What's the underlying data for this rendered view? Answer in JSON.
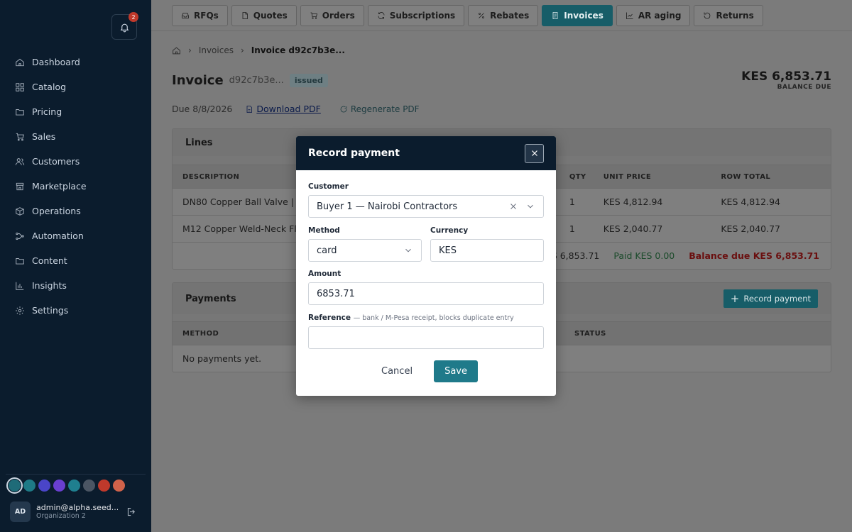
{
  "notifications": {
    "count": "2"
  },
  "sidebar": {
    "items": [
      {
        "label": "Dashboard",
        "icon": "home-icon"
      },
      {
        "label": "Catalog",
        "icon": "grid-icon"
      },
      {
        "label": "Pricing",
        "icon": "folder-icon"
      },
      {
        "label": "Sales",
        "icon": "cart-icon"
      },
      {
        "label": "Customers",
        "icon": "users-icon"
      },
      {
        "label": "Marketplace",
        "icon": "store-icon"
      },
      {
        "label": "Operations",
        "icon": "box-icon"
      },
      {
        "label": "Automation",
        "icon": "flow-icon"
      },
      {
        "label": "Content",
        "icon": "folder-icon"
      },
      {
        "label": "Insights",
        "icon": "chart-icon"
      },
      {
        "label": "Settings",
        "icon": "gear-icon"
      }
    ],
    "swatches": [
      "#1f6b78",
      "#1e7a86",
      "#4a45c8",
      "#6a3fd0",
      "#1f7f8f",
      "#4b5563",
      "#c0392b",
      "#d0624a"
    ],
    "user": {
      "initials": "AD",
      "email": "admin@alpha.seed....",
      "org": "Organization 2"
    }
  },
  "tabs": [
    {
      "label": "RFQs",
      "icon": "inbox-icon"
    },
    {
      "label": "Quotes",
      "icon": "doc-icon"
    },
    {
      "label": "Orders",
      "icon": "cart-icon"
    },
    {
      "label": "Subscriptions",
      "icon": "refresh-icon"
    },
    {
      "label": "Rebates",
      "icon": "percent-icon"
    },
    {
      "label": "Invoices",
      "icon": "doc-icon",
      "active": true
    },
    {
      "label": "AR aging",
      "icon": "chart-icon"
    },
    {
      "label": "Returns",
      "icon": "undo-icon"
    }
  ],
  "breadcrumb": {
    "parent": "Invoices",
    "current": "Invoice d92c7b3e..."
  },
  "invoice": {
    "title": "Invoice",
    "ref": "d92c7b3e...",
    "status": "issued",
    "balance": "KES 6,853.71",
    "balance_label": "BALANCE DUE",
    "due": "Due 8/8/2026",
    "download": "Download PDF",
    "regenerate": "Regenerate PDF"
  },
  "lines": {
    "title": "Lines",
    "headers": {
      "description": "DESCRIPTION",
      "qty": "QTY",
      "unit_price": "UNIT PRICE",
      "row_total": "ROW TOTAL"
    },
    "rows": [
      {
        "description": "DN80 Copper Ball Valve | D",
        "qty": "1",
        "unit_price": "KES 4,812.94",
        "row_total": "KES 4,812.94"
      },
      {
        "description": "M12 Copper Weld-Neck Fla",
        "qty": "1",
        "unit_price": "KES 2,040.77",
        "row_total": "KES 2,040.77"
      }
    ],
    "totals": {
      "total": "ES 6,853.71",
      "paid": "Paid KES 0.00",
      "balance": "Balance due KES 6,853.71"
    }
  },
  "payments": {
    "title": "Payments",
    "record_button": "Record payment",
    "headers": {
      "method": "METHOD",
      "status": "STATUS"
    },
    "empty": "No payments yet."
  },
  "modal": {
    "title": "Record payment",
    "customer_label": "Customer",
    "customer_value": "Buyer 1 — Nairobi Contractors",
    "method_label": "Method",
    "method_value": "card",
    "currency_label": "Currency",
    "currency_value": "KES",
    "amount_label": "Amount",
    "amount_value": "6853.71",
    "reference_label": "Reference",
    "reference_hint": "— bank / M-Pesa receipt, blocks duplicate entry",
    "reference_value": "",
    "cancel": "Cancel",
    "save": "Save"
  }
}
